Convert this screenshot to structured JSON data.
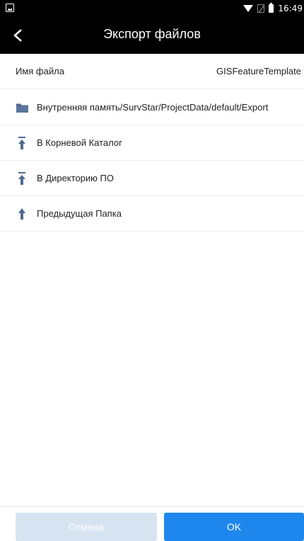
{
  "status_bar": {
    "time": "16:49"
  },
  "header": {
    "title": "Экспорт файлов"
  },
  "file_name": {
    "label": "Имя файла",
    "value": "GISFeatureTemplate"
  },
  "path": {
    "label": "Внутренняя память/SurvStar/ProjectData/default/Export"
  },
  "nav_items": {
    "root": "В Корневой Каталог",
    "software_dir": "В Директорию ПО",
    "parent": "Предыдущая Папка"
  },
  "buttons": {
    "cancel": "Отмена",
    "ok": "OK"
  },
  "colors": {
    "icon": "#4f6a90",
    "accent": "#1e87ee",
    "disabled": "#d6e4f2"
  }
}
